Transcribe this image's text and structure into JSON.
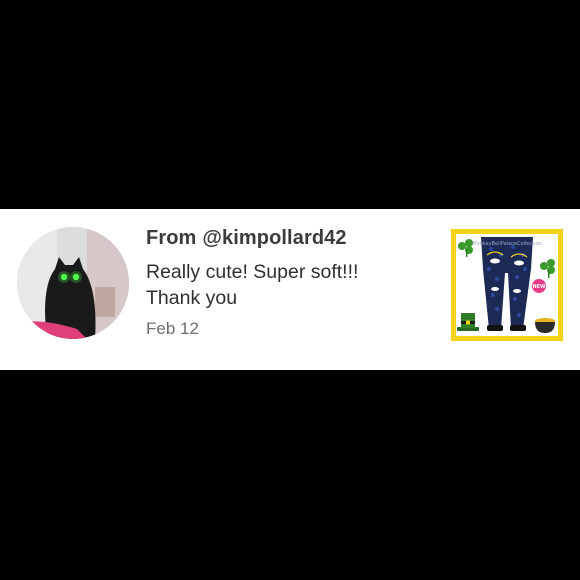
{
  "review": {
    "from_prefix": "From",
    "username": "@kimpollard42",
    "message_line1": "Really cute! Super soft!!!",
    "message_line2": "Thank you",
    "date": "Feb 12"
  },
  "product": {
    "badge": "NEW",
    "brand": "MonkeyBellPalaceCollection"
  },
  "colors": {
    "page_background": "#000000",
    "card_background": "#ffffff",
    "text_primary": "#3b3b3b",
    "text_secondary": "#6e6e6e",
    "product_frame": "#f3d21a"
  }
}
